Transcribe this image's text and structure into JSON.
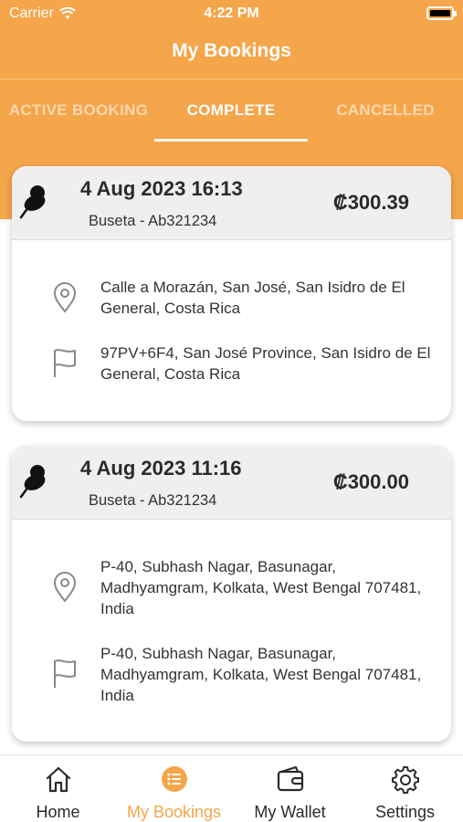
{
  "status_bar": {
    "carrier": "Carrier",
    "time": "4:22 PM"
  },
  "header": {
    "title": "My Bookings"
  },
  "tabs": [
    {
      "label": "ACTIVE BOOKING",
      "active": false
    },
    {
      "label": "COMPLETE",
      "active": true
    },
    {
      "label": "CANCELLED",
      "active": false
    }
  ],
  "bookings": [
    {
      "datetime": "4 Aug 2023 16:13",
      "vehicle": "Buseta - Ab321234",
      "price": "₡300.39",
      "pickup": "Calle a Morazán, San José, San Isidro de El General, Costa Rica",
      "dropoff": "97PV+6F4, San José Province, San Isidro de El General, Costa Rica"
    },
    {
      "datetime": "4 Aug 2023 11:16",
      "vehicle": "Buseta - Ab321234",
      "price": "₡300.00",
      "pickup": "P-40, Subhash Nagar, Basunagar, Madhyamgram, Kolkata, West Bengal 707481, India",
      "dropoff": "P-40, Subhash Nagar, Basunagar, Madhyamgram, Kolkata, West Bengal 707481, India"
    }
  ],
  "nav": [
    {
      "label": "Home",
      "icon": "home-icon",
      "active": false
    },
    {
      "label": "My Bookings",
      "icon": "list-icon",
      "active": true
    },
    {
      "label": "My Wallet",
      "icon": "wallet-icon",
      "active": false
    },
    {
      "label": "Settings",
      "icon": "gear-icon",
      "active": false
    }
  ],
  "colors": {
    "accent": "#f5a54a",
    "card_head": "#efefef",
    "text": "#2b2b2b"
  }
}
